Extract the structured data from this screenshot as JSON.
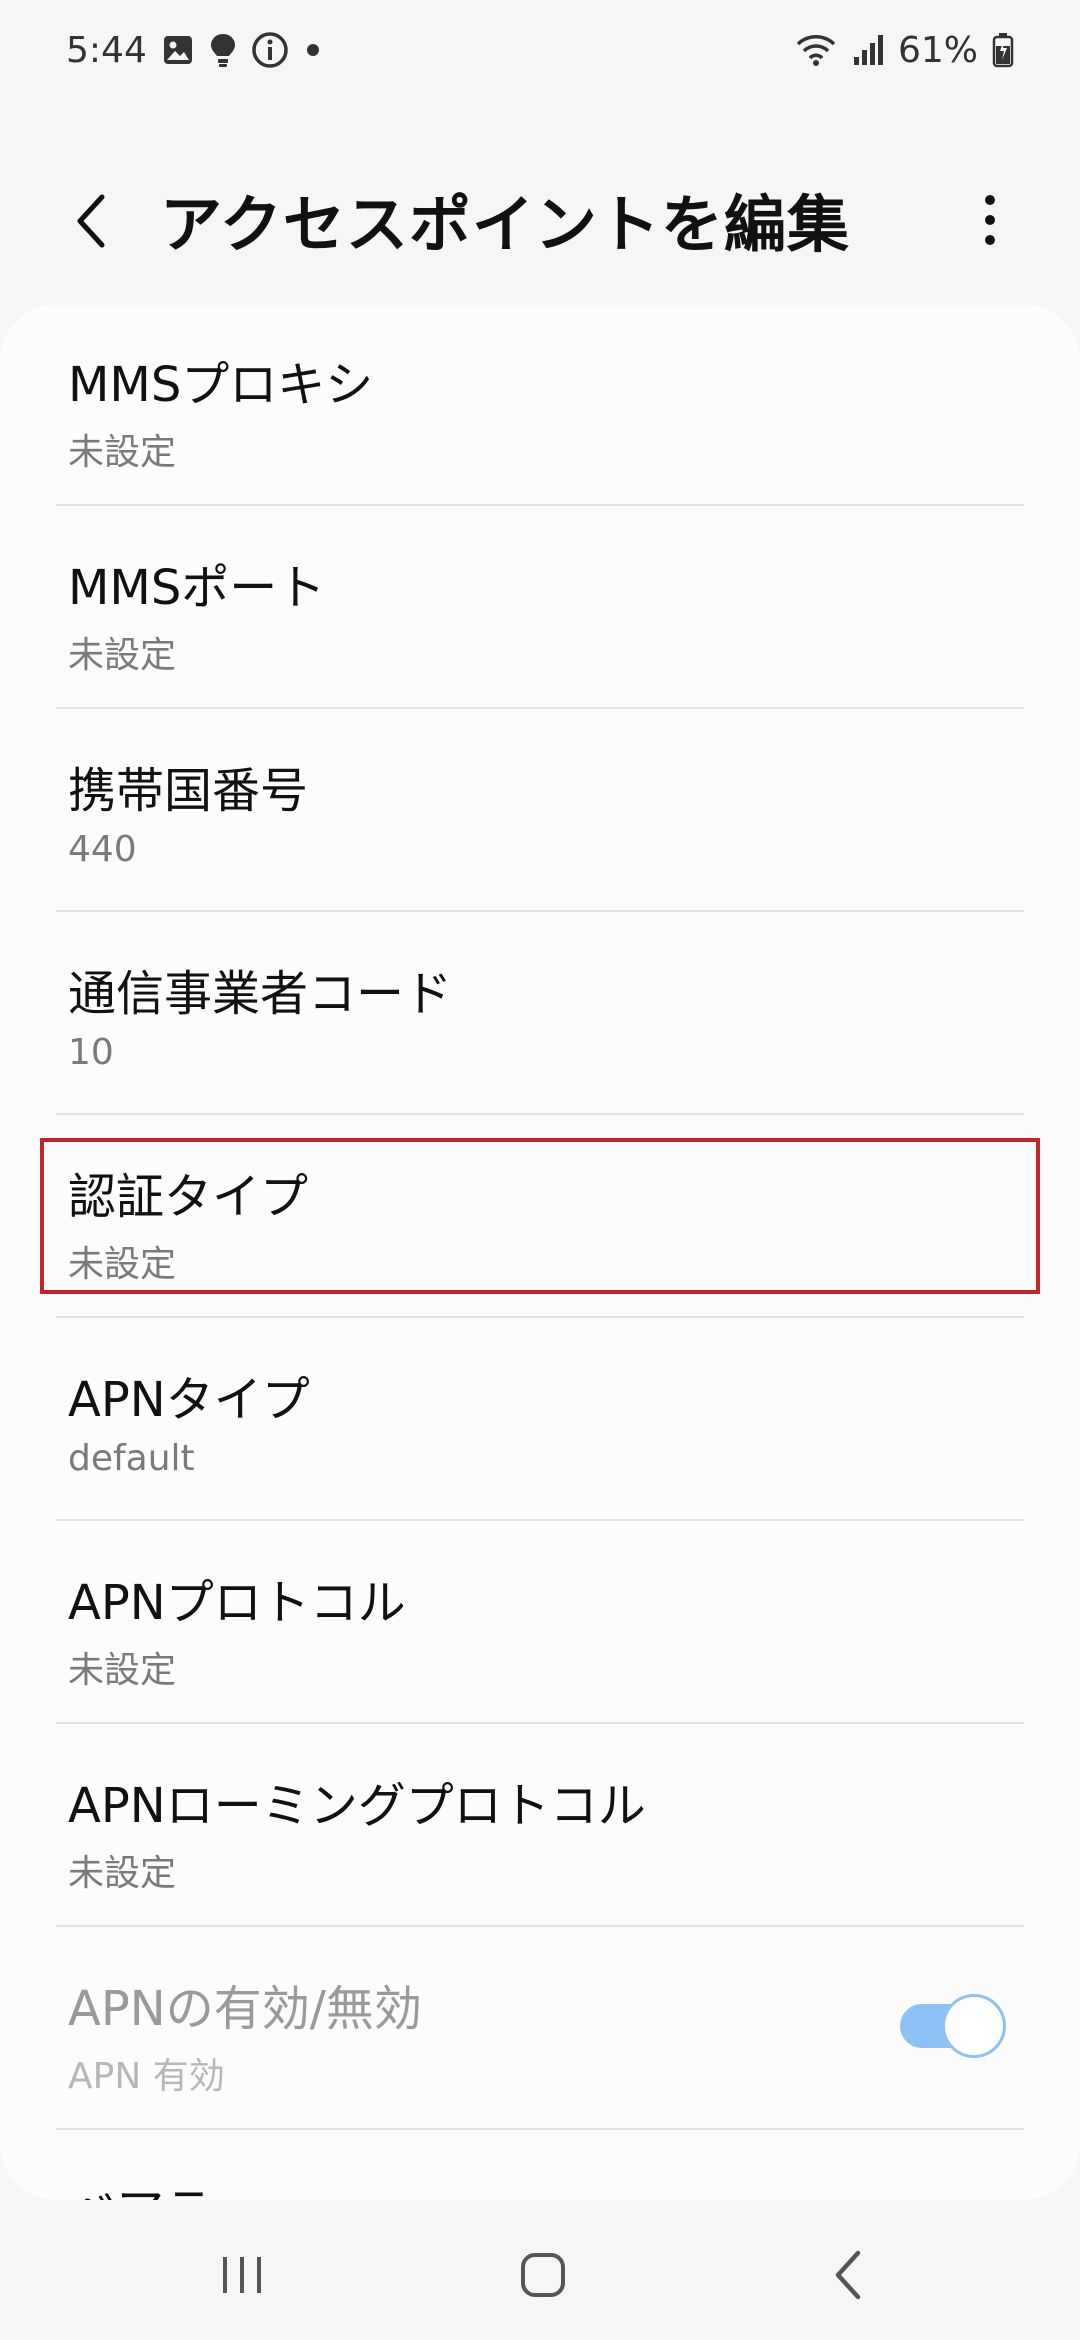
{
  "status_bar": {
    "time": "5:44",
    "battery": "61%",
    "icons": [
      "image-icon",
      "bulb-icon",
      "info-icon",
      "dot-icon",
      "wifi-icon",
      "signal-icon",
      "battery-icon"
    ]
  },
  "header": {
    "title": "アクセスポイントを編集",
    "back_icon": "chevron-left-icon",
    "more_icon": "more-vert-icon"
  },
  "settings": [
    {
      "title": "MMSプロキシ",
      "value": "未設定"
    },
    {
      "title": "MMSポート",
      "value": "未設定"
    },
    {
      "title": "携帯国番号",
      "value": "440"
    },
    {
      "title": "通信事業者コード",
      "value": "10"
    },
    {
      "title": "認証タイプ",
      "value": "未設定",
      "highlighted": true
    },
    {
      "title": "APNタイプ",
      "value": "default"
    },
    {
      "title": "APNプロトコル",
      "value": "未設定"
    },
    {
      "title": "APNローミングプロトコル",
      "value": "未設定"
    },
    {
      "title": "APNの有効/無効",
      "value": "APN 有効",
      "disabled": true,
      "toggle": true,
      "toggle_on": true
    },
    {
      "title": "ベアラ",
      "value": ""
    }
  ],
  "colors": {
    "background": "#f6f6f6",
    "card": "#fcfcfc",
    "highlight_border": "#c8232c",
    "toggle": "#8ec2f7"
  },
  "nav_bar": {
    "icons": [
      "recents-icon",
      "home-icon",
      "back-icon"
    ]
  }
}
